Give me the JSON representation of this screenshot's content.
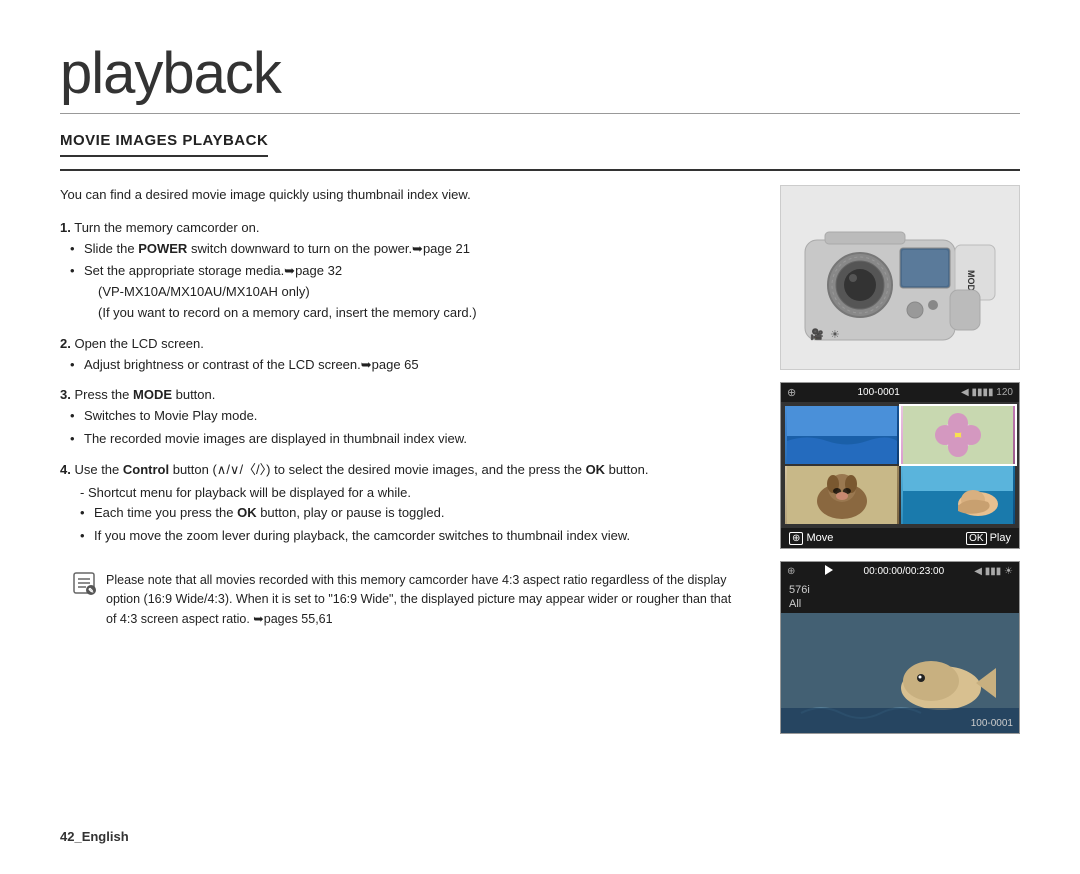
{
  "page": {
    "title": "playback",
    "section_title": "MOVIE IMAGES PLAYBACK",
    "footer": "42_English"
  },
  "intro": "You can find a desired movie image quickly using thumbnail index view.",
  "steps": [
    {
      "number": "1.",
      "main": "Turn the memory camcorder on.",
      "bullets": [
        "Slide the POWER switch downward to turn on the power.➥page 21",
        "Set the appropriate storage media.➥page 32\n(VP-MX10A/MX10AU/MX10AH only)\n(If you want to record on a memory card, insert the memory card.)"
      ]
    },
    {
      "number": "2.",
      "main": "Open the LCD screen.",
      "bullets": [
        "Adjust brightness or contrast of the LCD screen.➥page 65"
      ]
    },
    {
      "number": "3.",
      "main": "Press the MODE button.",
      "bullets": [
        "Switches to Movie Play mode.",
        "The recorded movie images are displayed in thumbnail index view."
      ]
    },
    {
      "number": "4.",
      "main": "Use the Control button (∧/∨/〈/〉) to select the desired movie images, and the press the OK button.",
      "sub": "- Shortcut menu for playback will be displayed for a while.",
      "bullets": [
        "Each time you press the OK button, play or pause is toggled.",
        "If you move the zoom lever during playback, the camcorder switches to thumbnail index view."
      ]
    }
  ],
  "note": "Please note that all movies recorded with this memory camcorder have 4:3 aspect ratio regardless of the display option (16:9 Wide/4:3). When it is set to \"16:9 Wide\", the displayed picture may appear wider or rougher than that of 4:3 screen aspect ratio. ➥pages 55,61",
  "thumbnail_screen": {
    "file_id": "100-0001",
    "footer_move": "Move",
    "footer_play": "Play"
  },
  "playback_screen": {
    "timecode": "00:00:00/00:23:00",
    "file_id": "100-0001",
    "resolution": "576i",
    "channel": "All"
  }
}
